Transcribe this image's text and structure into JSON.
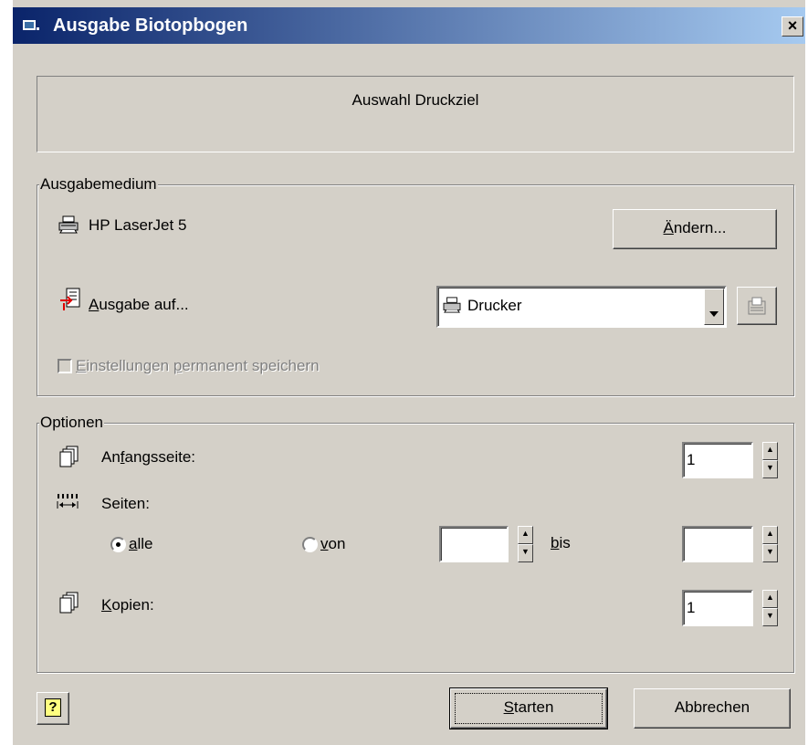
{
  "window": {
    "title": "Ausgabe Biotopbogen",
    "close_glyph": "×"
  },
  "header": {
    "text": "Auswahl Druckziel"
  },
  "ausgabemedium": {
    "legend": "Ausgabemedium",
    "printer_name": "HP LaserJet 5",
    "change_button": {
      "accel": "Ä",
      "rest": "ndern..."
    },
    "output_label": {
      "accel": "A",
      "rest": "usgabe auf..."
    },
    "output_select_value": "Drucker",
    "save_checkbox": {
      "pre": "",
      "accel": "E",
      "mid": "instellungen ",
      "accel2": "p",
      "post": "ermanent speichern",
      "checked": false,
      "disabled": true
    }
  },
  "optionen": {
    "legend": "Optionen",
    "start_page": {
      "pre": "An",
      "accel": "f",
      "post": "angsseite:",
      "value": "1"
    },
    "pages": {
      "label": "Seiten:"
    },
    "radio_all": {
      "pre": "",
      "accel": "a",
      "post": "lle",
      "checked": true
    },
    "radio_von": {
      "pre": "",
      "accel": "v",
      "post": "on",
      "checked": false
    },
    "von_value": "",
    "bis_label": {
      "accel": "b",
      "rest": "is"
    },
    "bis_value": "",
    "copies": {
      "accel": "K",
      "post": "opien:",
      "value": "1"
    }
  },
  "footer": {
    "help_glyph": "?",
    "start_button": {
      "accel": "S",
      "rest": "tarten"
    },
    "cancel_button": "Abbrechen"
  },
  "icons": {
    "printer": "printer-icon",
    "output": "output-document-icon",
    "pages": "pages-icon",
    "copies": "copies-icon"
  }
}
